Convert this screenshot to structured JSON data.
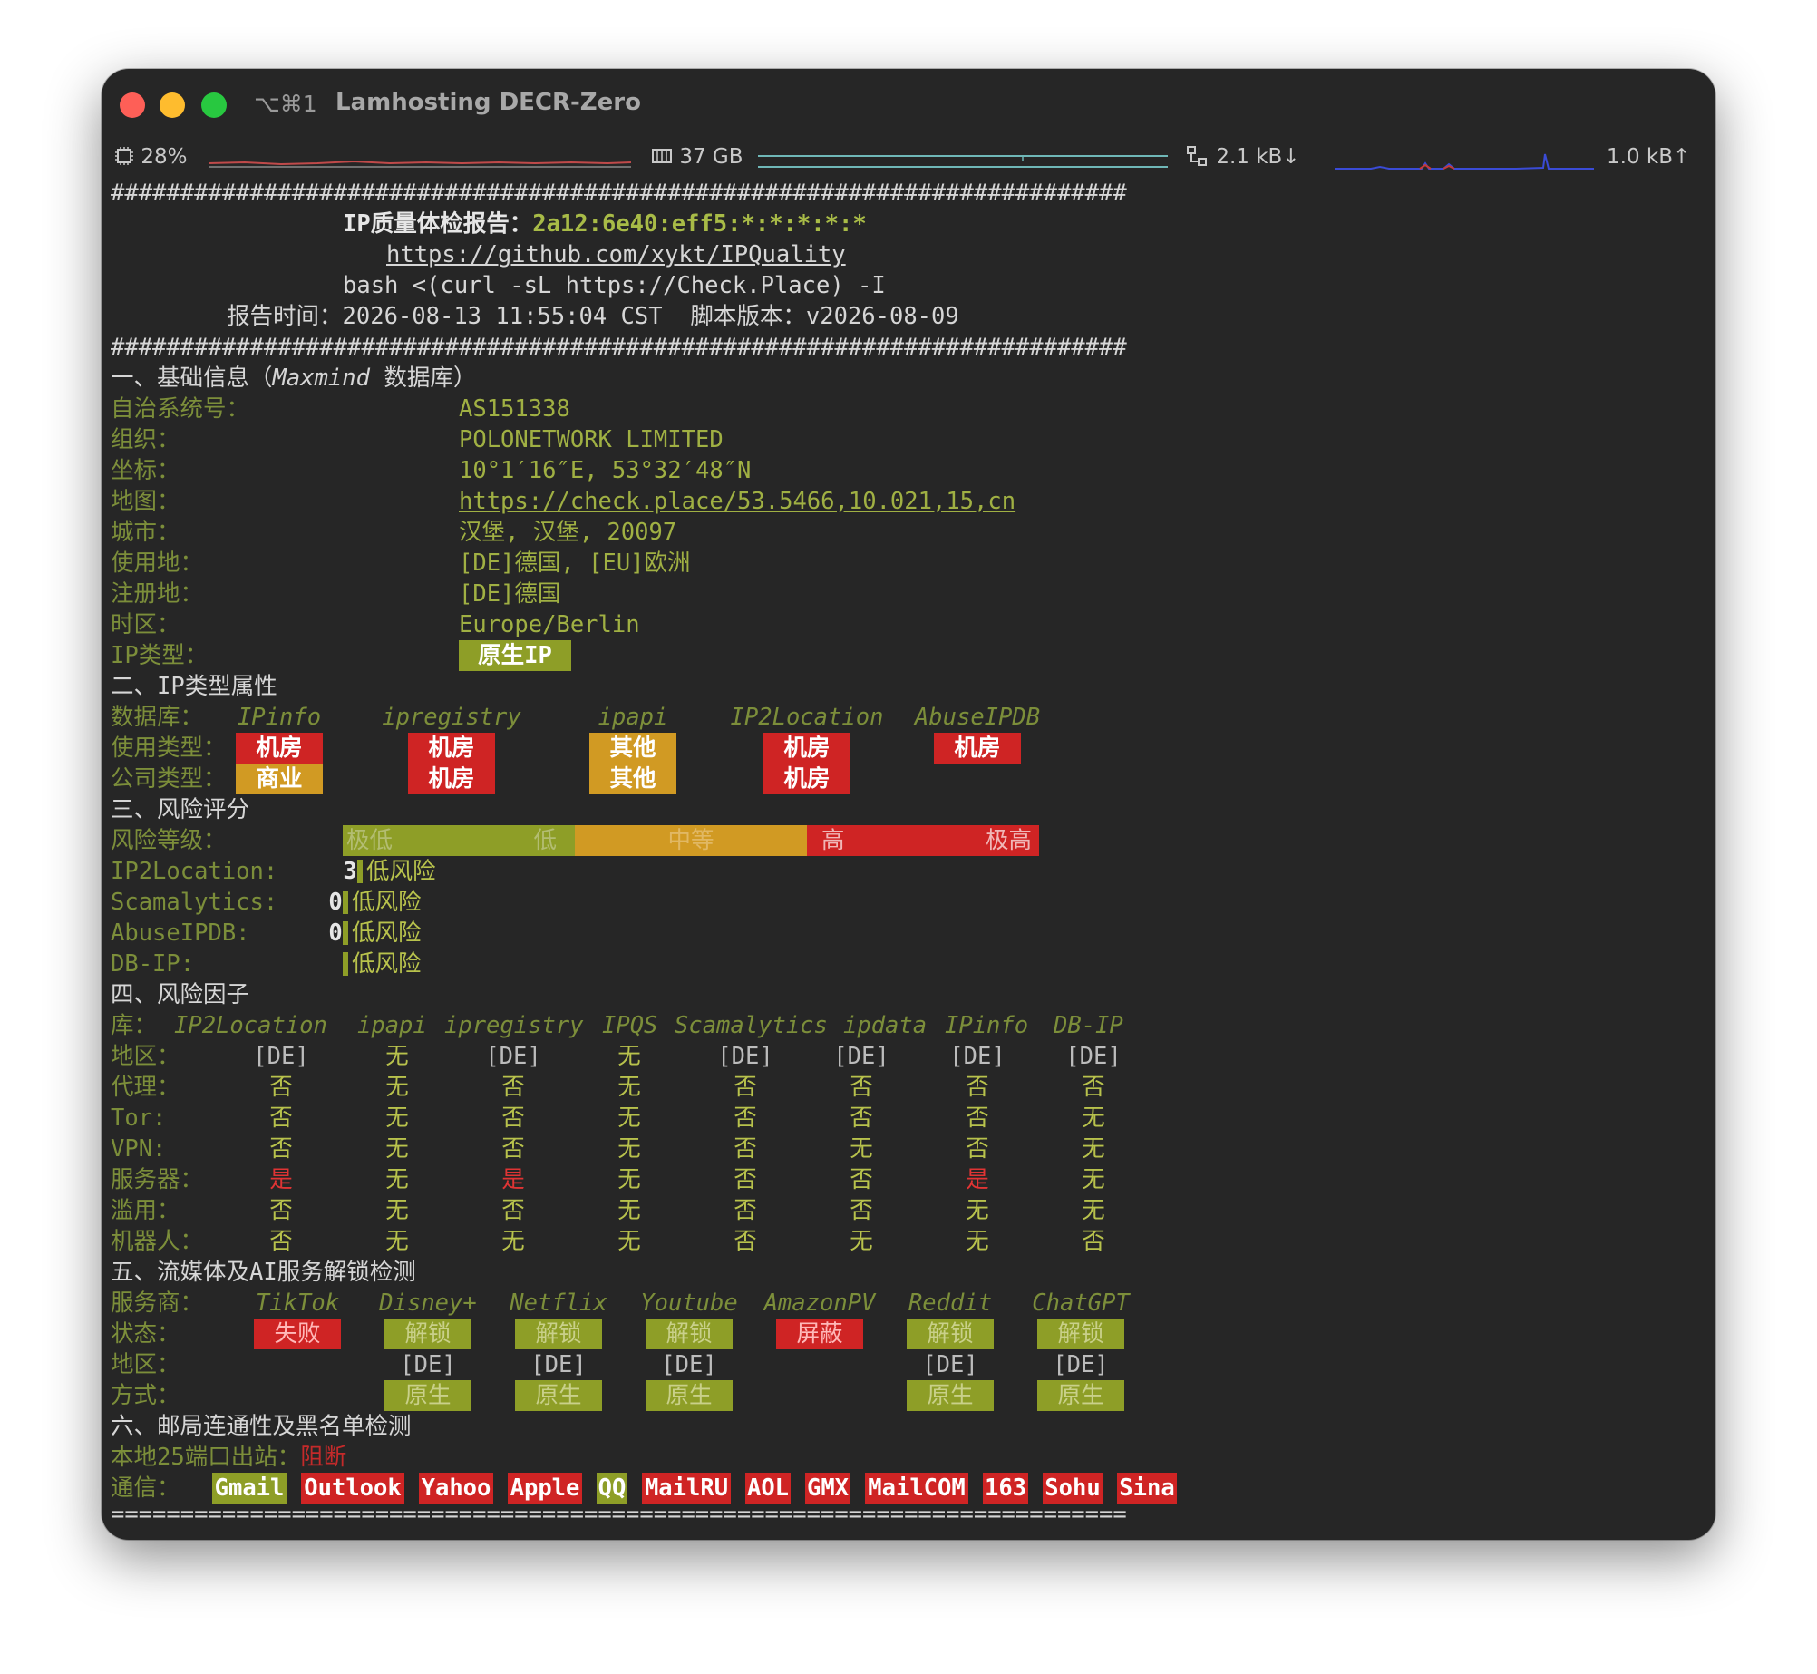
{
  "window": {
    "shortcut": "⌥⌘1",
    "title": "Lamhosting DECR-Zero"
  },
  "status": {
    "cpu_icon": "cpu-icon",
    "cpu": "28%",
    "mem_icon": "memory-icon",
    "mem": "37 GB",
    "net_icon": "network-icon",
    "down": "2.1 kB↓",
    "up": "1.0 kB↑"
  },
  "report": {
    "hash_line": "#########################################################################",
    "title_label": "IP质量体检报告：",
    "title_ip": "2a12:6e40:eff5:*:*:*:*:*",
    "repo_url": "https://github.com/xykt/IPQuality",
    "command": "bash <(curl -sL https://Check.Place) -I",
    "time_label": "报告时间：",
    "time_value": "2026-08-13 11:55:04 CST",
    "version_label": "脚本版本：",
    "version_value": "v2026-08-09",
    "footer_line": "========================================================================="
  },
  "basic": {
    "heading_prefix": "一、基础信息（",
    "heading_db": "Maxmind",
    "heading_suffix": " 数据库）",
    "rows": [
      {
        "label": "自治系统号：",
        "value": "AS151338"
      },
      {
        "label": "组织：",
        "value": "POLONETWORK LIMITED"
      },
      {
        "label": "坐标：",
        "value": "10°1′16″E, 53°32′48″N"
      },
      {
        "label": "地图：",
        "value": "https://check.place/53.5466,10.021,15,cn"
      },
      {
        "label": "城市：",
        "value": "汉堡, 汉堡, 20097"
      },
      {
        "label": "使用地：",
        "value": "[DE]德国, [EU]欧洲"
      },
      {
        "label": "注册地：",
        "value": "[DE]德国"
      },
      {
        "label": "时区：",
        "value": "Europe/Berlin"
      }
    ],
    "ip_type_label": "IP类型：",
    "ip_type_value": "原生IP"
  },
  "iptype": {
    "heading": "二、IP类型属性",
    "db_label": "数据库：",
    "databases": [
      "IPinfo",
      "ipregistry",
      "ipapi",
      "IP2Location",
      "AbuseIPDB"
    ],
    "usage_label": "使用类型：",
    "usage": [
      "机房",
      "机房",
      "其他",
      "机房",
      "机房"
    ],
    "company_label": "公司类型：",
    "company": [
      "商业",
      "机房",
      "其他",
      "机房"
    ]
  },
  "risk": {
    "heading": "三、风险评分",
    "level_label": "风险等级：",
    "scale": [
      "极低",
      "低",
      "中等",
      "高",
      "极高"
    ],
    "rows": [
      {
        "label": "IP2Location:",
        "score": "3",
        "text": "低风险"
      },
      {
        "label": "Scamalytics:",
        "score": "0",
        "text": "低风险"
      },
      {
        "label": "AbuseIPDB:",
        "score": "0",
        "text": "低风险"
      },
      {
        "label": "DB-IP:",
        "score": "",
        "text": "低风险"
      }
    ]
  },
  "factors": {
    "heading": "四、风险因子",
    "lib_label": "库：",
    "columns": [
      "IP2Location",
      "ipapi",
      "ipregistry",
      "IPQS",
      "Scamalytics",
      "ipdata",
      "IPinfo",
      "DB-IP"
    ],
    "rows": [
      {
        "label": "地区：",
        "values": [
          "[DE]",
          "无",
          "[DE]",
          "无",
          "[DE]",
          "[DE]",
          "[DE]",
          "[DE]"
        ]
      },
      {
        "label": "代理：",
        "values": [
          "否",
          "无",
          "否",
          "无",
          "否",
          "否",
          "否",
          "否"
        ]
      },
      {
        "label": "Tor:",
        "values": [
          "否",
          "无",
          "否",
          "无",
          "否",
          "否",
          "否",
          "无"
        ]
      },
      {
        "label": "VPN:",
        "values": [
          "否",
          "无",
          "否",
          "无",
          "否",
          "无",
          "否",
          "无"
        ]
      },
      {
        "label": "服务器：",
        "values": [
          "是",
          "无",
          "是",
          "无",
          "否",
          "否",
          "是",
          "无"
        ]
      },
      {
        "label": "滥用：",
        "values": [
          "否",
          "无",
          "否",
          "无",
          "否",
          "否",
          "无",
          "无"
        ]
      },
      {
        "label": "机器人：",
        "values": [
          "否",
          "无",
          "无",
          "无",
          "否",
          "无",
          "无",
          "否"
        ]
      }
    ]
  },
  "streaming": {
    "heading": "五、流媒体及AI服务解锁检测",
    "provider_label": "服务商：",
    "status_label": "状态：",
    "region_label": "地区：",
    "method_label": "方式：",
    "services": [
      {
        "name": "TikTok",
        "status": "失败",
        "region": "",
        "method": ""
      },
      {
        "name": "Disney+",
        "status": "解锁",
        "region": "[DE]",
        "method": "原生"
      },
      {
        "name": "Netflix",
        "status": "解锁",
        "region": "[DE]",
        "method": "原生"
      },
      {
        "name": "Youtube",
        "status": "解锁",
        "region": "[DE]",
        "method": "原生"
      },
      {
        "name": "AmazonPV",
        "status": "屏蔽",
        "region": "",
        "method": ""
      },
      {
        "name": "Reddit",
        "status": "解锁",
        "region": "[DE]",
        "method": "原生"
      },
      {
        "name": "ChatGPT",
        "status": "解锁",
        "region": "[DE]",
        "method": "原生"
      }
    ]
  },
  "mail": {
    "heading": "六、邮局连通性及黑名单检测",
    "port_label": "本地25端口出站：",
    "port_value": "阻断",
    "comm_label": "通信：",
    "providers": [
      {
        "name": "Gmail",
        "status": "ok"
      },
      {
        "name": "Outlook",
        "status": "fail"
      },
      {
        "name": "Yahoo",
        "status": "fail"
      },
      {
        "name": "Apple",
        "status": "fail"
      },
      {
        "name": "QQ",
        "status": "ok"
      },
      {
        "name": "MailRU",
        "status": "fail"
      },
      {
        "name": "AOL",
        "status": "fail"
      },
      {
        "name": "GMX",
        "status": "fail"
      },
      {
        "name": "MailCOM",
        "status": "fail"
      },
      {
        "name": "163",
        "status": "fail"
      },
      {
        "name": "Sohu",
        "status": "fail"
      },
      {
        "name": "Sina",
        "status": "fail"
      }
    ]
  }
}
